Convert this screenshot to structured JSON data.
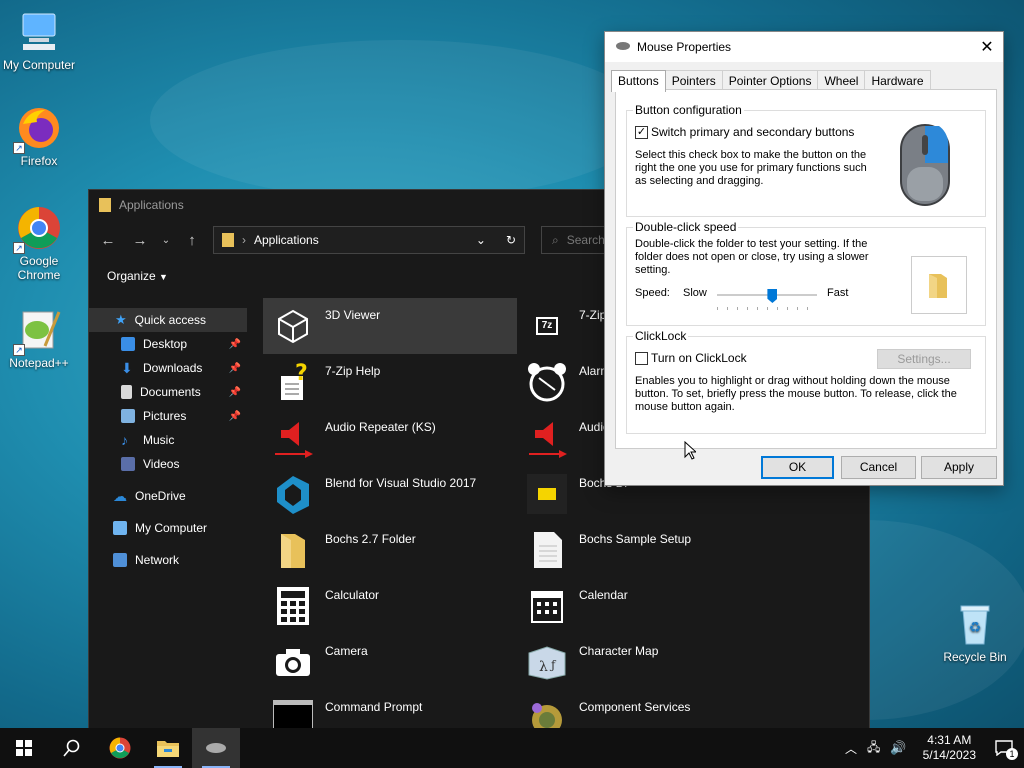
{
  "desktop": {
    "icons": [
      {
        "label": "My Computer"
      },
      {
        "label": "Firefox"
      },
      {
        "label": "Google Chrome"
      },
      {
        "label": "Notepad++"
      },
      {
        "label": "Recycle Bin"
      }
    ]
  },
  "explorer": {
    "title": "Applications",
    "address": "Applications",
    "search_placeholder": "Search A",
    "organize_label": "Organize",
    "nav": [
      {
        "label": "Quick access",
        "icon": "star-icon"
      },
      {
        "label": "Desktop",
        "icon": "desktop-icon",
        "pinned": true
      },
      {
        "label": "Downloads",
        "icon": "downloads-icon",
        "pinned": true
      },
      {
        "label": "Documents",
        "icon": "documents-icon",
        "pinned": true
      },
      {
        "label": "Pictures",
        "icon": "pictures-icon",
        "pinned": true
      },
      {
        "label": "Music",
        "icon": "music-icon"
      },
      {
        "label": "Videos",
        "icon": "videos-icon"
      },
      {
        "label": "OneDrive",
        "icon": "onedrive-icon"
      },
      {
        "label": "My Computer",
        "icon": "computer-icon"
      },
      {
        "label": "Network",
        "icon": "network-icon"
      }
    ],
    "apps": [
      {
        "label": "3D Viewer",
        "icon": "cube-icon"
      },
      {
        "label": "7-Zip",
        "icon": "7zip-icon"
      },
      {
        "label": "7-Zip Help",
        "icon": "help-document-icon"
      },
      {
        "label": "Alarm",
        "icon": "alarm-clock-icon"
      },
      {
        "label": "Audio Repeater (KS)",
        "icon": "speaker-arrow-icon"
      },
      {
        "label": "Audio",
        "icon": "speaker-arrow-icon"
      },
      {
        "label": "Blend for Visual Studio 2017",
        "icon": "blend-icon"
      },
      {
        "label": "Bochs Di",
        "icon": "bochs-icon"
      },
      {
        "label": "Bochs 2.7 Folder",
        "icon": "folder-icon"
      },
      {
        "label": "Bochs Sample Setup",
        "icon": "text-file-icon"
      },
      {
        "label": "Calculator",
        "icon": "calculator-icon"
      },
      {
        "label": "Calendar",
        "icon": "calendar-icon"
      },
      {
        "label": "Camera",
        "icon": "camera-icon"
      },
      {
        "label": "Character Map",
        "icon": "character-map-icon"
      },
      {
        "label": "Command Prompt",
        "icon": "command-prompt-icon"
      },
      {
        "label": "Component Services",
        "icon": "component-services-icon"
      }
    ]
  },
  "dialog": {
    "title": "Mouse Properties",
    "tabs": [
      "Buttons",
      "Pointers",
      "Pointer Options",
      "Wheel",
      "Hardware"
    ],
    "active_tab": "Buttons",
    "button_config": {
      "title": "Button configuration",
      "checkbox_label": "Switch primary and secondary buttons",
      "checked": true,
      "description": "Select this check box to make the button on the right the one you use for primary functions such as selecting and dragging."
    },
    "double_click": {
      "title": "Double-click speed",
      "description": "Double-click the folder to test your setting. If the folder does not open or close, try using a slower setting.",
      "speed_label": "Speed:",
      "slow_label": "Slow",
      "fast_label": "Fast",
      "slider_position": 0.56
    },
    "clicklock": {
      "title": "ClickLock",
      "checkbox_label": "Turn on ClickLock",
      "checked": false,
      "settings_label": "Settings...",
      "description": "Enables you to highlight or drag without holding down the mouse button. To set, briefly press the mouse button. To release, click the mouse button again."
    },
    "buttons": {
      "ok": "OK",
      "cancel": "Cancel",
      "apply": "Apply"
    }
  },
  "taskbar": {
    "time": "4:31 AM",
    "date": "5/14/2023",
    "notification_count": "1"
  },
  "colors": {
    "accent": "#0078d7",
    "folder": "#e8c15a",
    "explorer_bg": "#191919"
  }
}
